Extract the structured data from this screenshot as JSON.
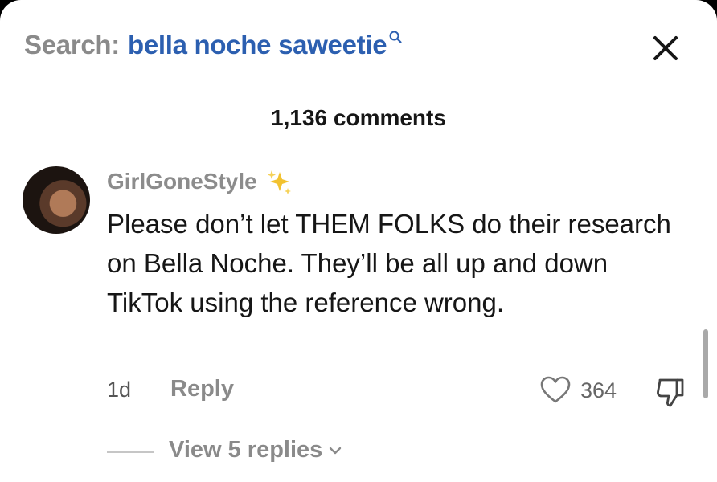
{
  "search": {
    "prefix": "Search:",
    "query": "bella noche saweetie"
  },
  "header": {
    "comment_count": "1,136 comments"
  },
  "comment": {
    "username": "GirlGoneStyle",
    "text": "Please don’t let THEM FOLKS do their research on Bella Noche. They’ll be all up and down TikTok using the reference wrong.",
    "timestamp": "1d",
    "reply_label": "Reply",
    "like_count": "364",
    "view_replies_label": "View 5 replies"
  },
  "icons": {
    "search": "search-icon",
    "close": "close-icon",
    "sparkles": "sparkles-icon",
    "like": "heart-icon",
    "dislike": "thumbs-down-icon",
    "expand": "chevron-down-icon"
  },
  "colors": {
    "search_term": "#2c5fb0",
    "muted_text": "#8a8a8a",
    "body_text": "#161616",
    "sparkle": "#f2c230"
  }
}
